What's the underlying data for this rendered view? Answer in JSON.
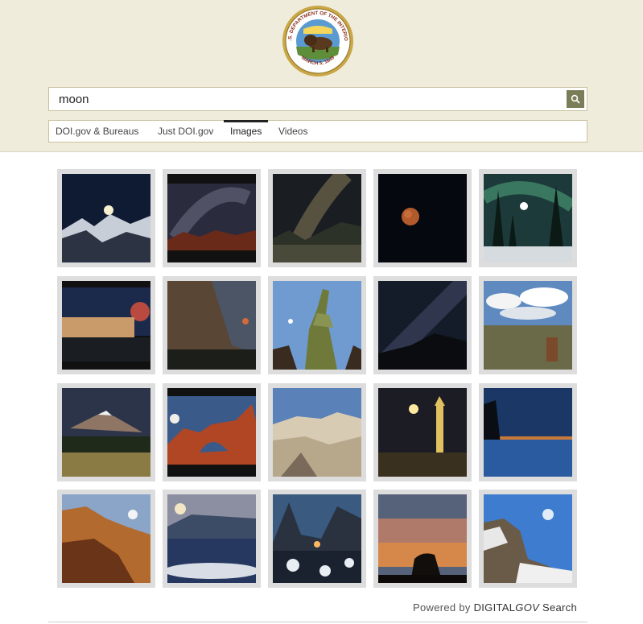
{
  "header": {
    "seal_top_text": "U.S. DEPARTMENT OF THE INTERIOR",
    "seal_bottom_text": "MARCH 3, 1849"
  },
  "search": {
    "query": "moon",
    "button_icon": "search-icon"
  },
  "tabs": [
    {
      "label": "DOI.gov & Bureaus",
      "active": false
    },
    {
      "label": "Just DOI.gov",
      "active": false
    },
    {
      "label": "Images",
      "active": true
    },
    {
      "label": "Videos",
      "active": false
    }
  ],
  "results": {
    "count": 20
  },
  "footer": {
    "powered_by": "Powered by",
    "brand_a": "DIGITAL",
    "brand_b": "GOV",
    "brand_c": "Search"
  },
  "colors": {
    "header_bg": "#f0ecdc",
    "search_button": "#7a7d58",
    "tile_frame": "#dddddd"
  }
}
